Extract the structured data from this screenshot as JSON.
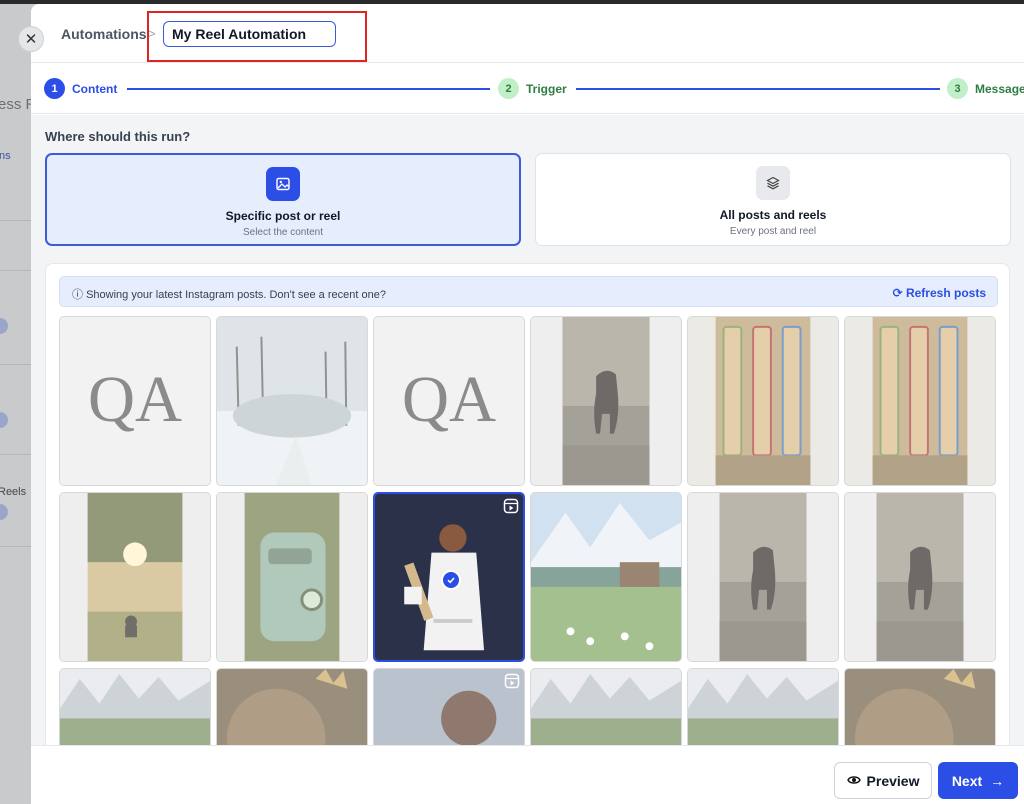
{
  "background": {
    "fragments": [
      "ess R",
      "ns",
      "Reels"
    ]
  },
  "header": {
    "breadcrumb": "Automations",
    "separator": ">",
    "automation_name": "My Reel Automation"
  },
  "stepper": {
    "steps": [
      {
        "number": "1",
        "label": "Content",
        "state": "active"
      },
      {
        "number": "2",
        "label": "Trigger",
        "state": "pending"
      },
      {
        "number": "3",
        "label": "Message",
        "state": "pending"
      }
    ]
  },
  "content": {
    "question": "Where should this run?",
    "options": [
      {
        "title": "Specific post or reel",
        "subtitle": "Select the content",
        "icon": "image-icon",
        "selected": true
      },
      {
        "title": "All posts and reels",
        "subtitle": "Every post and reel",
        "icon": "layers-icon",
        "selected": false
      }
    ],
    "info": "Showing your latest Instagram posts. Don't see a recent one?",
    "refresh_label": "Refresh posts"
  },
  "posts": [
    {
      "kind": "qa-logo"
    },
    {
      "kind": "snow-park"
    },
    {
      "kind": "qa-logo"
    },
    {
      "kind": "horse"
    },
    {
      "kind": "cricket-bats"
    },
    {
      "kind": "cricket-bats"
    },
    {
      "kind": "tree-sunset"
    },
    {
      "kind": "robot"
    },
    {
      "kind": "cricketer",
      "reel": true,
      "selected": true
    },
    {
      "kind": "alpine-lake"
    },
    {
      "kind": "horse"
    },
    {
      "kind": "horse"
    },
    {
      "kind": "mountains"
    },
    {
      "kind": "lion-crown"
    },
    {
      "kind": "cricketer-close",
      "reel": true
    },
    {
      "kind": "mountains"
    },
    {
      "kind": "mountains"
    },
    {
      "kind": "lion-crown"
    }
  ],
  "footer": {
    "preview_label": "Preview",
    "next_label": "Next"
  },
  "colors": {
    "accent": "#2b4ee6",
    "step_pending_bg": "#bff0c8",
    "step_pending_fg": "#2e7d43",
    "highlight": "#e02424"
  }
}
